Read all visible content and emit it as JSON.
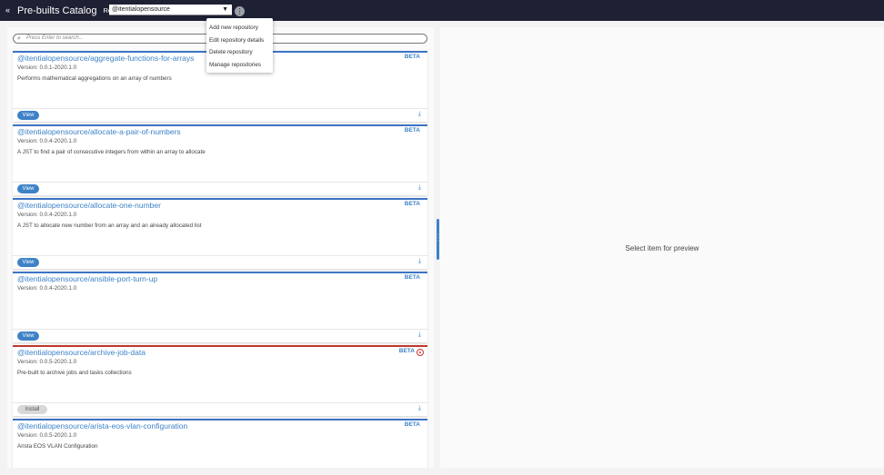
{
  "header": {
    "collapse_glyph": "«",
    "title": "Pre-builts Catalog",
    "repository_label": "Repository",
    "repository_value": "@itentialopensource",
    "kebab_glyph": "⋮"
  },
  "menu": {
    "items": [
      {
        "label": "Add new repository"
      },
      {
        "label": "Edit repository details"
      },
      {
        "label": "Delete repository"
      },
      {
        "label": "Manage repositories"
      }
    ]
  },
  "search": {
    "placeholder": "Press Enter to search..."
  },
  "cards": [
    {
      "name": "@itentialopensource/aggregate-functions-for-arrays",
      "badge": "BETA",
      "version": "Version: 0.0.1-2020.1.0",
      "description": "Performs mathematical aggregations on an array of numbers",
      "action": "View"
    },
    {
      "name": "@itentialopensource/allocate-a-pair-of-numbers",
      "badge": "BETA",
      "version": "Version: 0.0.4-2020.1.0",
      "description": "A JST to find a pair of consecutive integers from within an array to allocate",
      "action": "View"
    },
    {
      "name": "@itentialopensource/allocate-one-number",
      "badge": "BETA",
      "version": "Version: 0.0.4-2020.1.0",
      "description": "A JST to allocate new number from an array and an already allocated list",
      "action": "View"
    },
    {
      "name": "@itentialopensource/ansible-port-turn-up",
      "badge": "BETA",
      "version": "Version: 0.0.4-2020.1.0",
      "description": "",
      "action": "View"
    },
    {
      "name": "@itentialopensource/archive-job-data",
      "badge": "BETA",
      "version": "Version: 0.0.5-2020.1.0",
      "description": "Pre-built to archive jobs and tasks collections",
      "action": "Install"
    },
    {
      "name": "@itentialopensource/arista-eos-vlan-configuration",
      "badge": "BETA",
      "version": "Version: 0.0.5-2020.1.0",
      "description": "Arista EOS VLAN Configuration",
      "action": ""
    }
  ],
  "preview": {
    "empty_text": "Select item for preview"
  },
  "colors": {
    "accent": "#3d82c7",
    "header_bg": "#1e2033",
    "warning": "#c0392b"
  }
}
